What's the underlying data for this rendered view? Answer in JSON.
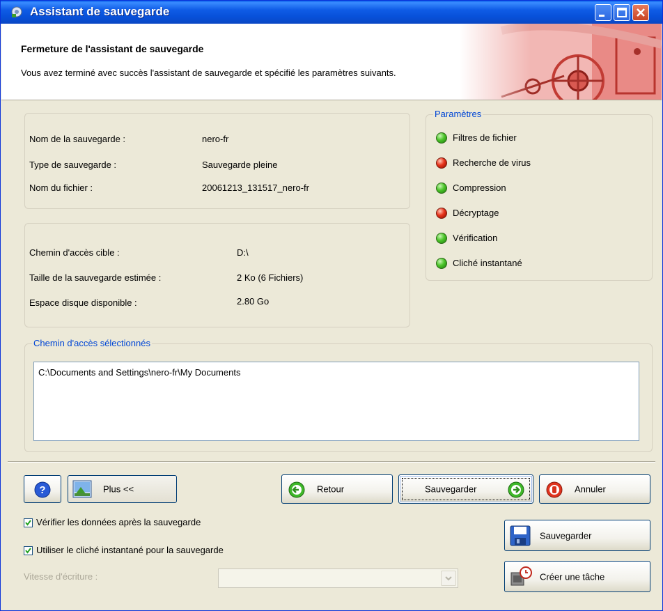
{
  "window": {
    "title": "Assistant de sauvegarde"
  },
  "header": {
    "title": "Fermeture de l'assistant de sauvegarde",
    "description": "Vous avez terminé avec succès l'assistant de sauvegarde et spécifié les paramètres suivants."
  },
  "summary": {
    "name_label": "Nom de la sauvegarde :",
    "name_value": "nero-fr",
    "type_label": "Type de sauvegarde :",
    "type_value": "Sauvegarde pleine",
    "file_label": "Nom du fichier :",
    "file_value": "20061213_131517_nero-fr"
  },
  "target": {
    "path_label": "Chemin d'accès cible :",
    "path_value": "D:\\",
    "size_label": "Taille de la sauvegarde estimée :",
    "size_value": "2 Ko (6 Fichiers)",
    "space_label": "Espace disque disponible :",
    "space_value": "2.80 Go"
  },
  "parameters": {
    "legend": "Paramètres",
    "items": [
      {
        "label": "Filtres de fichier",
        "status": "green"
      },
      {
        "label": "Recherche de virus",
        "status": "red"
      },
      {
        "label": "Compression",
        "status": "green"
      },
      {
        "label": "Décryptage",
        "status": "red"
      },
      {
        "label": "Vérification",
        "status": "green"
      },
      {
        "label": "Cliché instantané",
        "status": "green"
      }
    ]
  },
  "selected_paths": {
    "legend": "Chemin d'accès sélectionnés",
    "lines": [
      "C:\\Documents and Settings\\nero-fr\\My Documents"
    ]
  },
  "buttons": {
    "more": "Plus <<",
    "back": "Retour",
    "save": "Sauvegarder",
    "cancel": "Annuler",
    "save_settings": "Sauvegarder",
    "create_task": "Créer une tâche"
  },
  "options": {
    "verify_label": "Vérifier les données après la sauvegarde",
    "verify_checked": true,
    "snapshot_label": "Utiliser le cliché instantané pour la sauvegarde",
    "snapshot_checked": true,
    "speed_label": "Vitesse d'écriture :",
    "speed_value": ""
  },
  "colors": {
    "accent": "#0046D5",
    "led_green": "#4CC52A",
    "led_red": "#E8341C"
  }
}
